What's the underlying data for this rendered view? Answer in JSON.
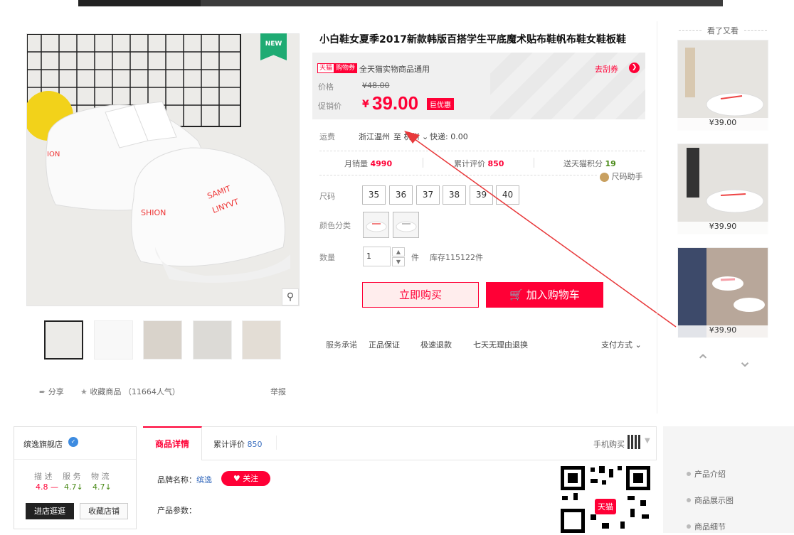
{
  "product": {
    "title": "小白鞋女夏季2017新款韩版百搭学生平底魔术贴布鞋帆布鞋女鞋板鞋",
    "badge_new": "NEW",
    "tag_tmall": "天猫",
    "tag_coupon": "购物券",
    "coupon_text": "全天猫实物商品通用",
    "get_coupon": "去刮券",
    "price_label": "价格",
    "old_price": "¥48.00",
    "promo_label": "促销价",
    "currency": "¥",
    "price": "39.00",
    "big_deal": "巨优惠",
    "shipping_label": "运费",
    "shipping_from": "浙江温州",
    "shipping_to": "至 杭州",
    "shipping_fee": "快递: 0.00",
    "monthly_label": "月销量",
    "monthly_value": "4990",
    "reviews_label": "累计评价",
    "reviews_value": "850",
    "points_label": "送天猫积分",
    "points_value": "19",
    "size_helper": "尺码助手",
    "size_label": "尺码",
    "sizes": [
      "35",
      "36",
      "37",
      "38",
      "39",
      "40"
    ],
    "color_label": "颜色分类",
    "qty_label": "数量",
    "qty_value": "1",
    "qty_unit": "件",
    "stock": "库存115122件",
    "buy_now": "立即购买",
    "add_cart": "加入购物车",
    "service_label": "服务承诺",
    "services": [
      "正品保证",
      "极速退款",
      "七天无理由退换"
    ],
    "payment": "支付方式",
    "share": "分享",
    "favorite": "收藏商品 （11664人气）",
    "report": "举报"
  },
  "see_also": {
    "title": "看了又看",
    "prices": [
      "¥39.00",
      "¥39.90",
      "¥39.90"
    ]
  },
  "shop": {
    "name": "缤逸旗舰店",
    "ratings_labels": [
      "描 述",
      "服 务",
      "物 流"
    ],
    "ratings": [
      "4.8",
      "4.7",
      "4.7"
    ],
    "enter_shop": "进店逛逛",
    "fav_shop": "收藏店铺"
  },
  "tabs": {
    "detail": "商品详情",
    "reviews": "累计评价",
    "reviews_count": "850",
    "mobile_buy": "手机购买"
  },
  "detail": {
    "brand_label": "品牌名称：",
    "brand": "缤逸",
    "follow": "关注",
    "params": "产品参数："
  },
  "side_nav": [
    "产品介绍",
    "商品展示图",
    "商品细节"
  ],
  "colors": {
    "accent": "#ff0036",
    "new_badge": "#1fab73"
  }
}
